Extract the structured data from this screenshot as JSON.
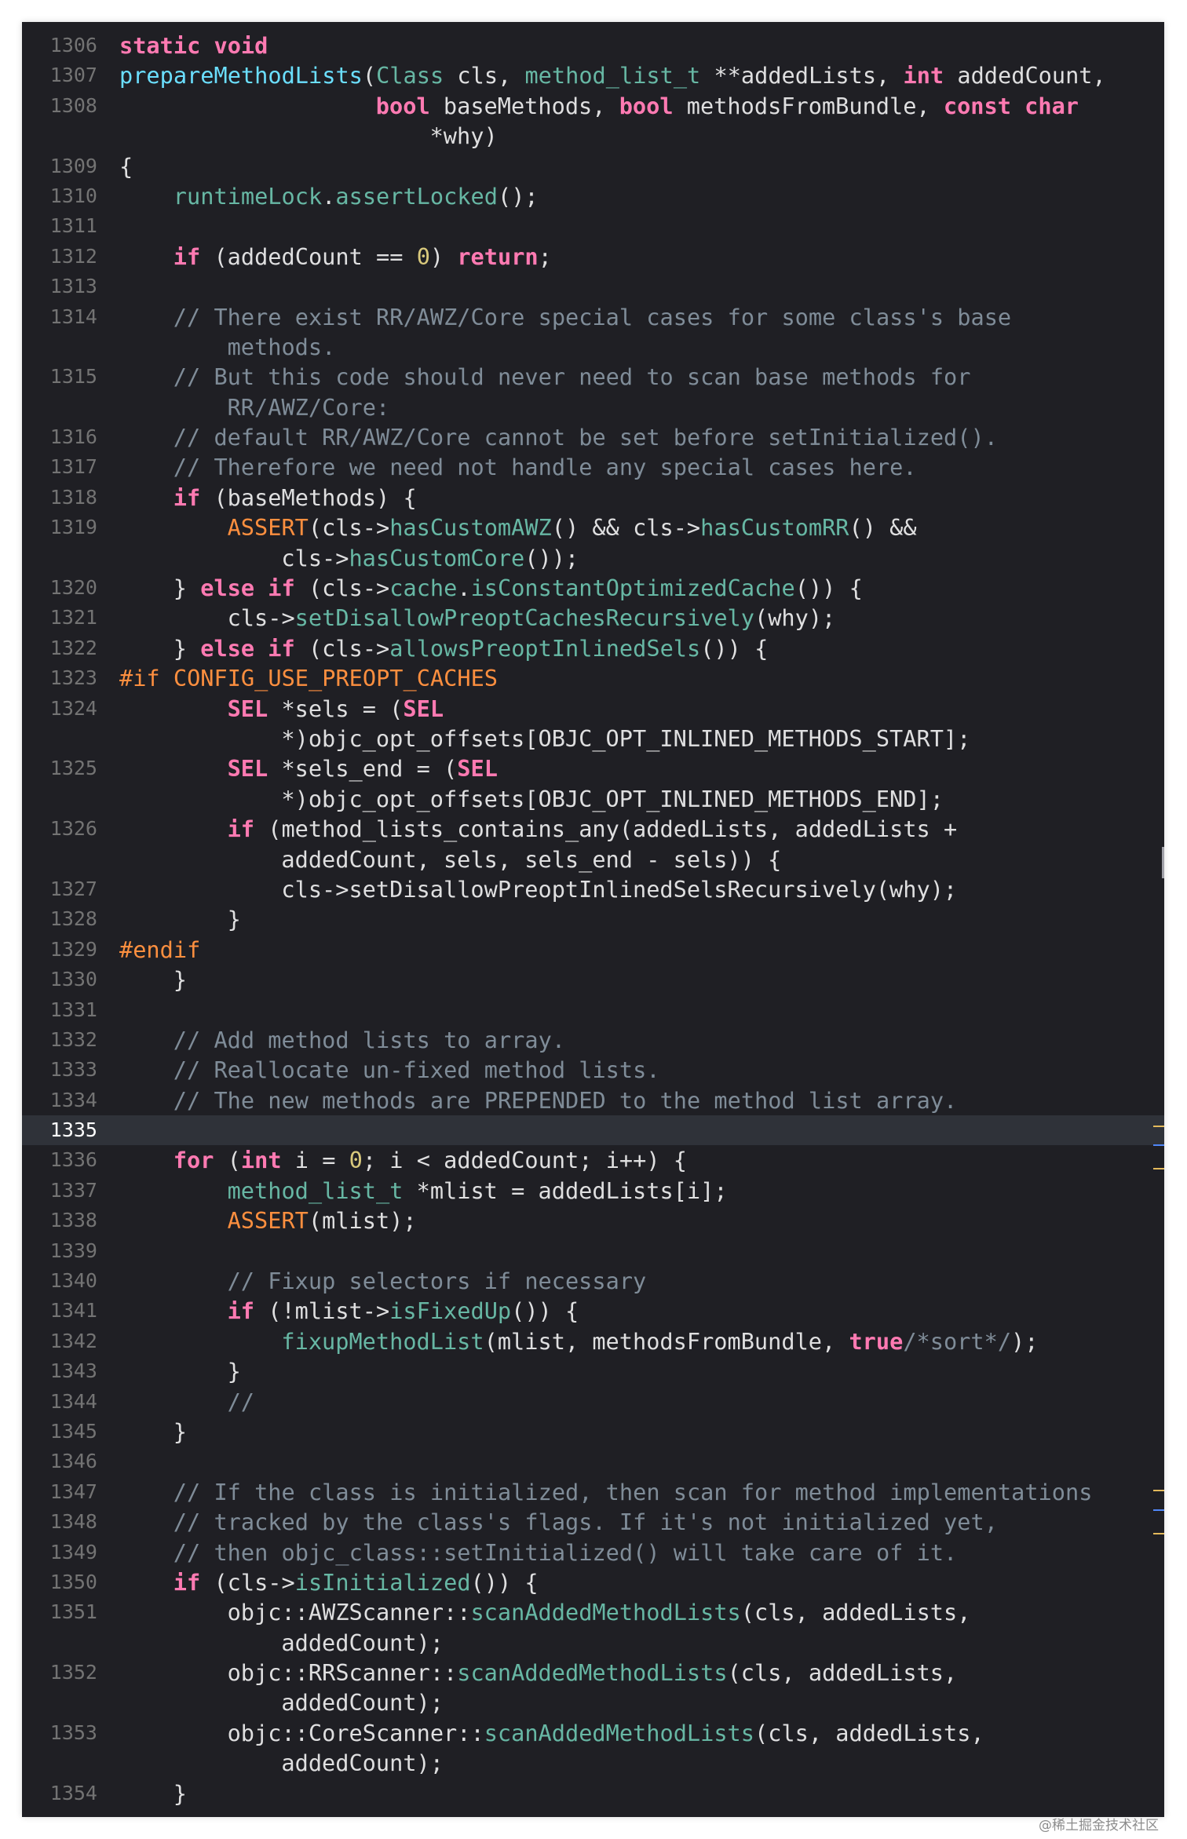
{
  "editor": {
    "current_line": "1335",
    "lines": [
      {
        "num": "1306",
        "indent": 0,
        "segs": [
          [
            "kw",
            "static void"
          ]
        ]
      },
      {
        "num": "1307",
        "indent": 0,
        "segs": [
          [
            "fn",
            "prepareMethodLists"
          ],
          [
            "plain",
            "("
          ],
          [
            "call",
            "Class"
          ],
          [
            "plain",
            " cls, "
          ],
          [
            "call",
            "method_list_t"
          ],
          [
            "plain",
            " **addedLists, "
          ],
          [
            "kw",
            "int"
          ],
          [
            "plain",
            " addedCount,"
          ]
        ]
      },
      {
        "num": "1308",
        "indent": 19,
        "segs": [
          [
            "kw",
            "bool"
          ],
          [
            "plain",
            " baseMethods, "
          ],
          [
            "kw",
            "bool"
          ],
          [
            "plain",
            " methodsFromBundle, "
          ],
          [
            "kw",
            "const char"
          ]
        ]
      },
      {
        "num": "",
        "indent": 23,
        "segs": [
          [
            "plain",
            "*why)"
          ]
        ]
      },
      {
        "num": "1309",
        "indent": 0,
        "segs": [
          [
            "plain",
            "{"
          ]
        ]
      },
      {
        "num": "1310",
        "indent": 4,
        "segs": [
          [
            "call",
            "runtimeLock"
          ],
          [
            "plain",
            "."
          ],
          [
            "call",
            "assertLocked"
          ],
          [
            "plain",
            "();"
          ]
        ]
      },
      {
        "num": "1311",
        "indent": 0,
        "segs": []
      },
      {
        "num": "1312",
        "indent": 4,
        "segs": [
          [
            "kw",
            "if"
          ],
          [
            "plain",
            " (addedCount == "
          ],
          [
            "num",
            "0"
          ],
          [
            "plain",
            ") "
          ],
          [
            "kw",
            "return"
          ],
          [
            "plain",
            ";"
          ]
        ]
      },
      {
        "num": "1313",
        "indent": 0,
        "segs": []
      },
      {
        "num": "1314",
        "indent": 4,
        "segs": [
          [
            "cmt",
            "// There exist RR/AWZ/Core special cases for some class's base"
          ]
        ]
      },
      {
        "num": "",
        "indent": 8,
        "segs": [
          [
            "cmt",
            "methods."
          ]
        ]
      },
      {
        "num": "1315",
        "indent": 4,
        "segs": [
          [
            "cmt",
            "// But this code should never need to scan base methods for"
          ]
        ]
      },
      {
        "num": "",
        "indent": 8,
        "segs": [
          [
            "cmt",
            "RR/AWZ/Core:"
          ]
        ]
      },
      {
        "num": "1316",
        "indent": 4,
        "segs": [
          [
            "cmt",
            "// default RR/AWZ/Core cannot be set before setInitialized()."
          ]
        ]
      },
      {
        "num": "1317",
        "indent": 4,
        "segs": [
          [
            "cmt",
            "// Therefore we need not handle any special cases here."
          ]
        ]
      },
      {
        "num": "1318",
        "indent": 4,
        "segs": [
          [
            "kw",
            "if"
          ],
          [
            "plain",
            " (baseMethods) {"
          ]
        ]
      },
      {
        "num": "1319",
        "indent": 8,
        "segs": [
          [
            "mac",
            "ASSERT"
          ],
          [
            "plain",
            "(cls->"
          ],
          [
            "call",
            "hasCustomAWZ"
          ],
          [
            "plain",
            "() && cls->"
          ],
          [
            "call",
            "hasCustomRR"
          ],
          [
            "plain",
            "() &&"
          ]
        ]
      },
      {
        "num": "",
        "indent": 12,
        "segs": [
          [
            "plain",
            "cls->"
          ],
          [
            "call",
            "hasCustomCore"
          ],
          [
            "plain",
            "());"
          ]
        ]
      },
      {
        "num": "1320",
        "indent": 4,
        "segs": [
          [
            "plain",
            "} "
          ],
          [
            "kw",
            "else if"
          ],
          [
            "plain",
            " (cls->"
          ],
          [
            "call",
            "cache"
          ],
          [
            "plain",
            "."
          ],
          [
            "call",
            "isConstantOptimizedCache"
          ],
          [
            "plain",
            "()) {"
          ]
        ]
      },
      {
        "num": "1321",
        "indent": 8,
        "segs": [
          [
            "plain",
            "cls->"
          ],
          [
            "call",
            "setDisallowPreoptCachesRecursively"
          ],
          [
            "plain",
            "(why);"
          ]
        ]
      },
      {
        "num": "1322",
        "indent": 4,
        "segs": [
          [
            "plain",
            "} "
          ],
          [
            "kw",
            "else if"
          ],
          [
            "plain",
            " (cls->"
          ],
          [
            "call",
            "allowsPreoptInlinedSels"
          ],
          [
            "plain",
            "()) {"
          ]
        ]
      },
      {
        "num": "1323",
        "indent": 0,
        "segs": [
          [
            "pp",
            "#if CONFIG_USE_PREOPT_CACHES"
          ]
        ]
      },
      {
        "num": "1324",
        "indent": 8,
        "segs": [
          [
            "kw",
            "SEL"
          ],
          [
            "plain",
            " *sels = ("
          ],
          [
            "kw",
            "SEL"
          ]
        ]
      },
      {
        "num": "",
        "indent": 12,
        "segs": [
          [
            "plain",
            "*)objc_opt_offsets[OBJC_OPT_INLINED_METHODS_START];"
          ]
        ]
      },
      {
        "num": "1325",
        "indent": 8,
        "segs": [
          [
            "kw",
            "SEL"
          ],
          [
            "plain",
            " *sels_end = ("
          ],
          [
            "kw",
            "SEL"
          ]
        ]
      },
      {
        "num": "",
        "indent": 12,
        "segs": [
          [
            "plain",
            "*)objc_opt_offsets[OBJC_OPT_INLINED_METHODS_END];"
          ]
        ]
      },
      {
        "num": "1326",
        "indent": 8,
        "segs": [
          [
            "kw",
            "if"
          ],
          [
            "plain",
            " (method_lists_contains_any(addedLists, addedLists +"
          ]
        ]
      },
      {
        "num": "",
        "indent": 12,
        "segs": [
          [
            "plain",
            "addedCount, sels, sels_end - sels)) {"
          ]
        ]
      },
      {
        "num": "1327",
        "indent": 12,
        "segs": [
          [
            "plain",
            "cls->setDisallowPreoptInlinedSelsRecursively(why);"
          ]
        ]
      },
      {
        "num": "1328",
        "indent": 8,
        "segs": [
          [
            "plain",
            "}"
          ]
        ]
      },
      {
        "num": "1329",
        "indent": 0,
        "segs": [
          [
            "pp",
            "#endif"
          ]
        ]
      },
      {
        "num": "1330",
        "indent": 4,
        "segs": [
          [
            "plain",
            "}"
          ]
        ]
      },
      {
        "num": "1331",
        "indent": 0,
        "segs": []
      },
      {
        "num": "1332",
        "indent": 4,
        "segs": [
          [
            "cmt",
            "// Add method lists to array."
          ]
        ]
      },
      {
        "num": "1333",
        "indent": 4,
        "segs": [
          [
            "cmt",
            "// Reallocate un-fixed method lists."
          ]
        ]
      },
      {
        "num": "1334",
        "indent": 4,
        "segs": [
          [
            "cmt",
            "// The new methods are PREPENDED to the method list array."
          ]
        ]
      },
      {
        "num": "1335",
        "indent": 0,
        "segs": []
      },
      {
        "num": "1336",
        "indent": 4,
        "segs": [
          [
            "kw",
            "for"
          ],
          [
            "plain",
            " ("
          ],
          [
            "kw",
            "int"
          ],
          [
            "plain",
            " i = "
          ],
          [
            "num",
            "0"
          ],
          [
            "plain",
            "; i < addedCount; i++) {"
          ]
        ]
      },
      {
        "num": "1337",
        "indent": 8,
        "segs": [
          [
            "call",
            "method_list_t"
          ],
          [
            "plain",
            " *mlist = addedLists[i];"
          ]
        ]
      },
      {
        "num": "1338",
        "indent": 8,
        "segs": [
          [
            "mac",
            "ASSERT"
          ],
          [
            "plain",
            "(mlist);"
          ]
        ]
      },
      {
        "num": "1339",
        "indent": 0,
        "segs": []
      },
      {
        "num": "1340",
        "indent": 8,
        "segs": [
          [
            "cmt",
            "// Fixup selectors if necessary"
          ]
        ]
      },
      {
        "num": "1341",
        "indent": 8,
        "segs": [
          [
            "kw",
            "if"
          ],
          [
            "plain",
            " (!mlist->"
          ],
          [
            "call",
            "isFixedUp"
          ],
          [
            "plain",
            "()) {"
          ]
        ]
      },
      {
        "num": "1342",
        "indent": 12,
        "segs": [
          [
            "call",
            "fixupMethodList"
          ],
          [
            "plain",
            "(mlist, methodsFromBundle, "
          ],
          [
            "kw",
            "true"
          ],
          [
            "cmt",
            "/*sort*/"
          ],
          [
            "plain",
            ");"
          ]
        ]
      },
      {
        "num": "1343",
        "indent": 8,
        "segs": [
          [
            "plain",
            "}"
          ]
        ]
      },
      {
        "num": "1344",
        "indent": 8,
        "segs": [
          [
            "cmt",
            "//"
          ]
        ]
      },
      {
        "num": "1345",
        "indent": 4,
        "segs": [
          [
            "plain",
            "}"
          ]
        ]
      },
      {
        "num": "1346",
        "indent": 0,
        "segs": []
      },
      {
        "num": "1347",
        "indent": 4,
        "segs": [
          [
            "cmt",
            "// If the class is initialized, then scan for method implementations"
          ]
        ]
      },
      {
        "num": "1348",
        "indent": 4,
        "segs": [
          [
            "cmt",
            "// tracked by the class's flags. If it's not initialized yet,"
          ]
        ]
      },
      {
        "num": "1349",
        "indent": 4,
        "segs": [
          [
            "cmt",
            "// then objc_class::setInitialized() will take care of it."
          ]
        ]
      },
      {
        "num": "1350",
        "indent": 4,
        "segs": [
          [
            "kw",
            "if"
          ],
          [
            "plain",
            " (cls->"
          ],
          [
            "call",
            "isInitialized"
          ],
          [
            "plain",
            "()) {"
          ]
        ]
      },
      {
        "num": "1351",
        "indent": 8,
        "segs": [
          [
            "plain",
            "objc::AWZScanner::"
          ],
          [
            "call",
            "scanAddedMethodLists"
          ],
          [
            "plain",
            "(cls, addedLists,"
          ]
        ]
      },
      {
        "num": "",
        "indent": 12,
        "segs": [
          [
            "plain",
            "addedCount);"
          ]
        ]
      },
      {
        "num": "1352",
        "indent": 8,
        "segs": [
          [
            "plain",
            "objc::RRScanner::"
          ],
          [
            "call",
            "scanAddedMethodLists"
          ],
          [
            "plain",
            "(cls, addedLists,"
          ]
        ]
      },
      {
        "num": "",
        "indent": 12,
        "segs": [
          [
            "plain",
            "addedCount);"
          ]
        ]
      },
      {
        "num": "1353",
        "indent": 8,
        "segs": [
          [
            "plain",
            "objc::CoreScanner::"
          ],
          [
            "call",
            "scanAddedMethodLists"
          ],
          [
            "plain",
            "(cls, addedLists,"
          ]
        ]
      },
      {
        "num": "",
        "indent": 12,
        "segs": [
          [
            "plain",
            "addedCount);"
          ]
        ]
      },
      {
        "num": "1354",
        "indent": 4,
        "segs": [
          [
            "plain",
            "}"
          ]
        ]
      }
    ]
  },
  "watermark": "@稀土掘金技术社区",
  "colors": {
    "background": "#1f1f24",
    "current_line_bg": "#2f3239",
    "line_number": "#737373",
    "plain": "#dfdfe0",
    "keyword": "#ff7ab2",
    "function_decl": "#6bdfff",
    "call": "#67b7a4",
    "comment": "#7f8c98",
    "number": "#d9c97c",
    "preprocessor": "#fd8f3f"
  }
}
